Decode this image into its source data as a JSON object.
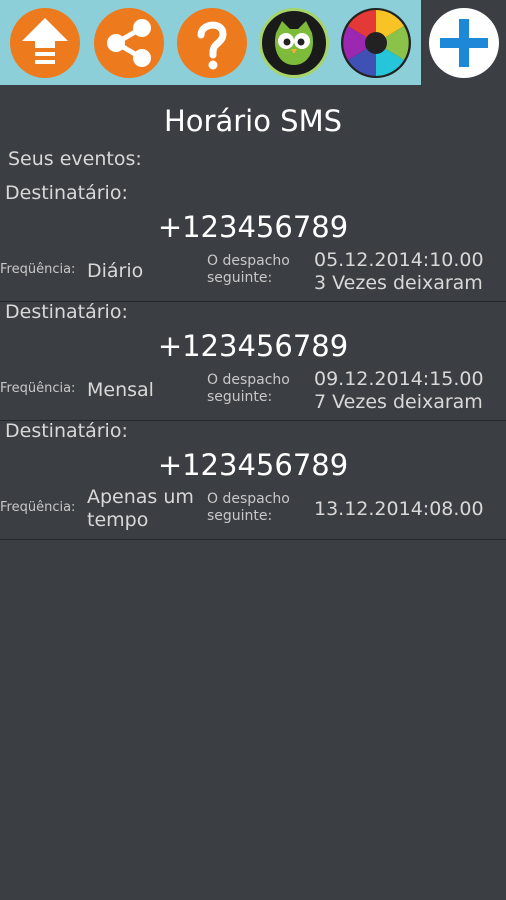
{
  "toolbar": {
    "icons": [
      "up-arrow-icon",
      "share-icon",
      "help-icon",
      "owl-icon",
      "aperture-icon"
    ],
    "add_icon": "plus-icon"
  },
  "page": {
    "title": "Horário SMS",
    "events_label": "Seus eventos:"
  },
  "labels": {
    "recipient": "Destinatário:",
    "frequency": "Freqüência:",
    "next_dispatch": "O despacho seguinte:"
  },
  "events": [
    {
      "phone": "+123456789",
      "frequency": "Diário",
      "next_date": "05.12.2014:10.00",
      "remaining": "3 Vezes deixaram"
    },
    {
      "phone": "+123456789",
      "frequency": "Mensal",
      "next_date": "09.12.2014:15.00",
      "remaining": "7 Vezes deixaram"
    },
    {
      "phone": "+123456789",
      "frequency": "Apenas um tempo",
      "next_date": "13.12.2014:08.00",
      "remaining": ""
    }
  ],
  "colors": {
    "toolbar_bg": "#8ccfd8",
    "accent_orange": "#ee7a1e",
    "add_blue": "#1e88d8",
    "background": "#3b3e42"
  }
}
